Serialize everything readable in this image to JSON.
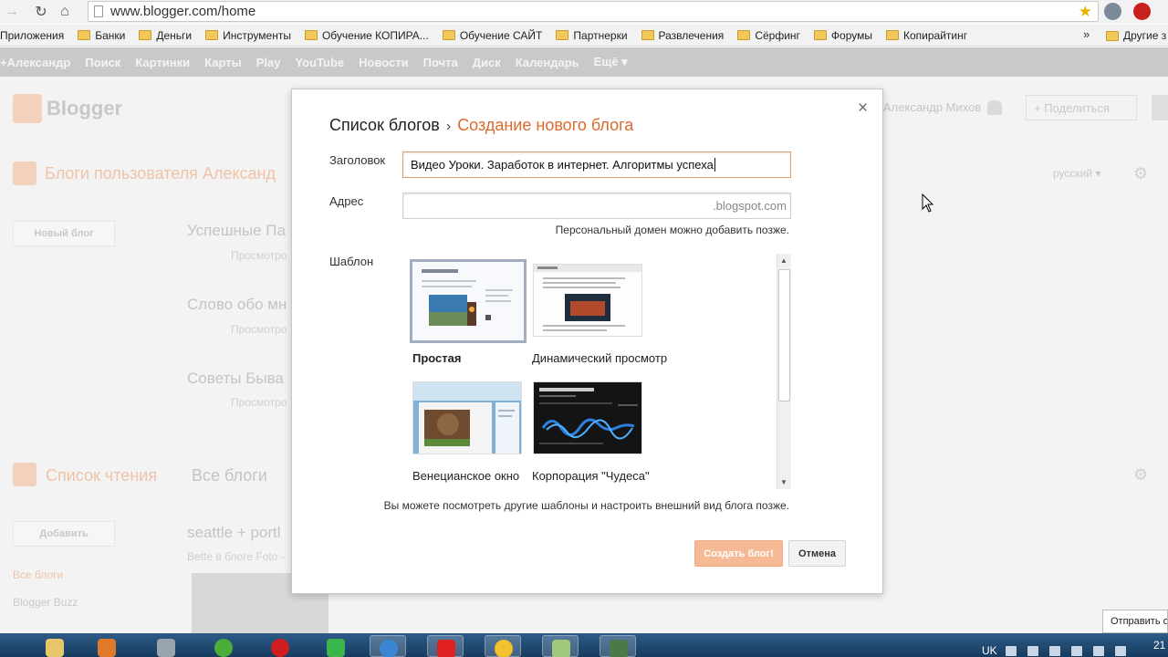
{
  "browser": {
    "url": "www.blogger.com/home",
    "bookmarks": [
      "Приложения",
      "Банки",
      "Деньги",
      "Инструменты",
      "Обучение КОПИРА...",
      "Обучение САЙТ",
      "Партнерки",
      "Развлечения",
      "Сёрфинг",
      "Форумы",
      "Копирайтинг"
    ],
    "more": "»",
    "other_bookmarks": "Другие з"
  },
  "google_bar": [
    "+Александр",
    "Поиск",
    "Картинки",
    "Карты",
    "Play",
    "YouTube",
    "Новости",
    "Почта",
    "Диск",
    "Календарь",
    "Ещё ▾"
  ],
  "blogger": {
    "logo": "Blogger",
    "user_name": "Александр Михов",
    "share_label": "+ Поделиться",
    "blogs_title": "Блоги пользователя Александ",
    "language": "русский ▾",
    "new_blog_button": "Новый блог",
    "blogs": [
      {
        "title": "Успешные Па",
        "sub": "Просмотро"
      },
      {
        "title": "Слово обо мн",
        "sub": "Просмотро"
      },
      {
        "title": "Советы Быва",
        "sub": "Просмотро"
      }
    ],
    "reading_list_title": "Список чтения",
    "all_blogs_tab": "Все блоги",
    "add_button": "Добавить",
    "side_links": [
      "Все блоги",
      "Blogger Buzz"
    ],
    "feed_title": "seattle + portl",
    "feed_sub": "Bette в блоге Foto -"
  },
  "modal": {
    "crumb_root": "Список блогов",
    "crumb_sep": "›",
    "crumb_current": "Создание нового блога",
    "title_label": "Заголовок",
    "title_value": "Видео Уроки. Заработок в интернет. Алгоритмы успеха",
    "address_label": "Адрес",
    "address_suffix": ".blogspot.com",
    "address_hint": "Персональный домен можно добавить позже.",
    "template_label": "Шаблон",
    "templates": [
      {
        "name": "Простая",
        "selected": true
      },
      {
        "name": "Динамический просмотр",
        "selected": false
      },
      {
        "name": "Венецианское окно",
        "selected": false
      },
      {
        "name": "Корпорация \"Чудеса\"",
        "selected": false
      }
    ],
    "footer_note": "Вы можете посмотреть другие шаблоны и настроить внешний вид блога позже.",
    "create_button": "Создать блог!",
    "cancel_button": "Отмена",
    "close": "×"
  },
  "feedback_button": "Отправить о",
  "taskbar": {
    "lang": "UK",
    "clock": "21"
  }
}
